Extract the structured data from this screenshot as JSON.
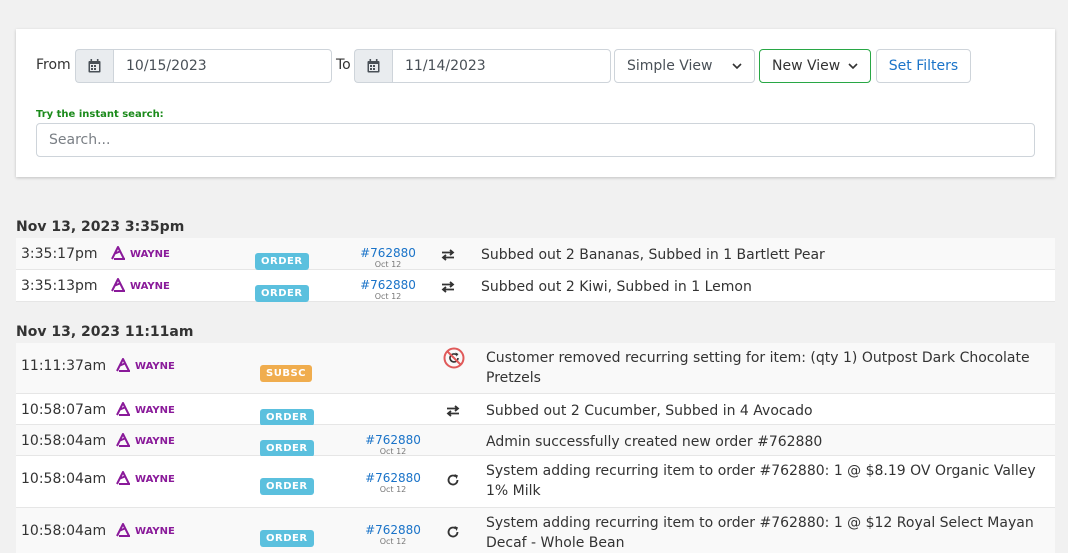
{
  "filters": {
    "from_label": "From",
    "to_label": "To",
    "from_date": "10/15/2023",
    "to_date": "11/14/2023",
    "view_mode": "Simple View",
    "view_name": "New View",
    "set_filters_label": "Set Filters",
    "instant_label": "Try the instant search:",
    "search_placeholder": "Search..."
  },
  "groups": [
    {
      "title": "Nov 13, 2023 3:35pm",
      "rows": [
        {
          "time": "3:35:17pm",
          "user": "WAYNE",
          "badge": "ORDER",
          "order": "#762880",
          "order_date": "Oct 12",
          "icon": "swap-icon",
          "desc": "Subbed out 2 Bananas, Subbed in 1 Bartlett Pear"
        },
        {
          "time": "3:35:13pm",
          "user": "WAYNE",
          "badge": "ORDER",
          "order": "#762880",
          "order_date": "Oct 12",
          "icon": "swap-icon",
          "desc": "Subbed out 2 Kiwi, Subbed in 1 Lemon"
        }
      ]
    },
    {
      "title": "Nov 13, 2023 11:11am",
      "rows": [
        {
          "time": "11:11:37am",
          "user": "WAYNE",
          "badge": "SUBSC",
          "order": "",
          "order_date": "",
          "icon": "cancel-recurring-icon",
          "desc": "Customer removed recurring setting for item: (qty 1) Outpost Dark Chocolate Pretzels"
        },
        {
          "time": "10:58:07am",
          "user": "WAYNE",
          "badge": "ORDER",
          "order": "",
          "order_date": "",
          "icon": "swap-icon",
          "desc": "Subbed out 2 Cucumber, Subbed in 4 Avocado"
        },
        {
          "time": "10:58:04am",
          "user": "WAYNE",
          "badge": "ORDER",
          "order": "#762880",
          "order_date": "Oct 12",
          "icon": "",
          "desc": "Admin successfully created new order #762880"
        },
        {
          "time": "10:58:04am",
          "user": "WAYNE",
          "badge": "ORDER",
          "order": "#762880",
          "order_date": "Oct 12",
          "icon": "recurring-icon",
          "desc": "System adding recurring item to order #762880: 1 @ $8.19 OV Organic Valley 1% Milk"
        },
        {
          "time": "10:58:04am",
          "user": "WAYNE",
          "badge": "ORDER",
          "order": "#762880",
          "order_date": "Oct 12",
          "icon": "recurring-icon",
          "desc": "System adding recurring item to order #762880: 1 @ $12 Royal Select Mayan Decaf - Whole Bean"
        }
      ]
    }
  ],
  "colors": {
    "link": "#1a73c8",
    "user": "#8a1a9a",
    "order_badge": "#5bc0de",
    "subsc_badge": "#f0ad4e",
    "instant_label": "#1a8a1a"
  }
}
